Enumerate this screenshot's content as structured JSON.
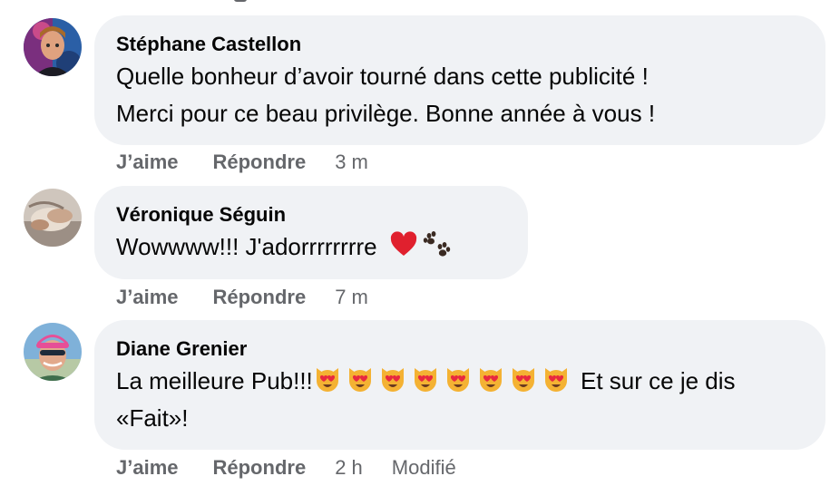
{
  "comments": [
    {
      "author": "Stéphane Castellon",
      "lines": [
        "Quelle bonheur d’avoir tourné dans cette publicité !",
        "Merci pour ce beau privilège. Bonne année à vous !"
      ],
      "like_label": "J’aime",
      "reply_label": "Répondre",
      "time": "3 m"
    },
    {
      "author": "Véronique Séguin",
      "text": "Wowwww!!! J'adorrrrrrrre",
      "emojis": [
        "red-heart-icon",
        "paw-prints-icon"
      ],
      "like_label": "J’aime",
      "reply_label": "Répondre",
      "time": "7 m"
    },
    {
      "author": "Diane Grenier",
      "text_before": "La meilleure Pub!!!",
      "emojis": [
        "heart-eyes-cat-icon",
        "heart-eyes-cat-icon",
        "heart-eyes-cat-icon",
        "heart-eyes-cat-icon",
        "heart-eyes-cat-icon",
        "heart-eyes-cat-icon",
        "heart-eyes-cat-icon",
        "heart-eyes-cat-icon"
      ],
      "text_after": " Et sur ce je dis",
      "line2": "«Fait»!",
      "like_label": "J’aime",
      "reply_label": "Répondre",
      "time": "2 h",
      "edited_label": "Modifié"
    }
  ],
  "colors": {
    "bubble": "#f0f2f5",
    "meta": "#65676b",
    "text": "#050505"
  }
}
